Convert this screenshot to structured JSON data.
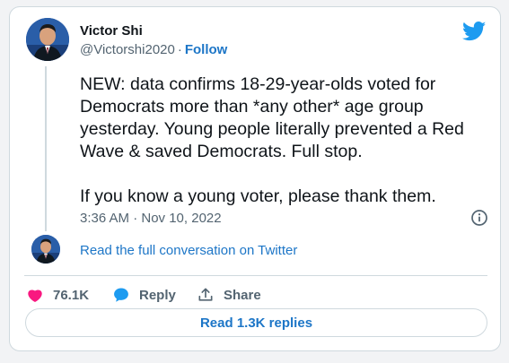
{
  "author": {
    "name": "Victor Shi",
    "handle": "@Victorshi2020",
    "separator": "·",
    "follow_label": "Follow"
  },
  "tweet": {
    "text": "NEW: data confirms 18-29-year-olds voted for Democrats more than *any other* age group yesterday. Young people literally prevented a Red Wave & saved Democrats. Full stop.\n\nIf you know a young voter, please thank them.",
    "timestamp": "3:36 AM · Nov 10, 2022"
  },
  "conversation_link": "Read the full conversation on Twitter",
  "actions": {
    "like_count": "76.1K",
    "reply_label": "Reply",
    "share_label": "Share"
  },
  "read_replies_label": "Read 1.3K replies",
  "colors": {
    "link_blue": "#1d76c7",
    "like_pink": "#f91880",
    "twitter_blue": "#1d9bf0"
  }
}
